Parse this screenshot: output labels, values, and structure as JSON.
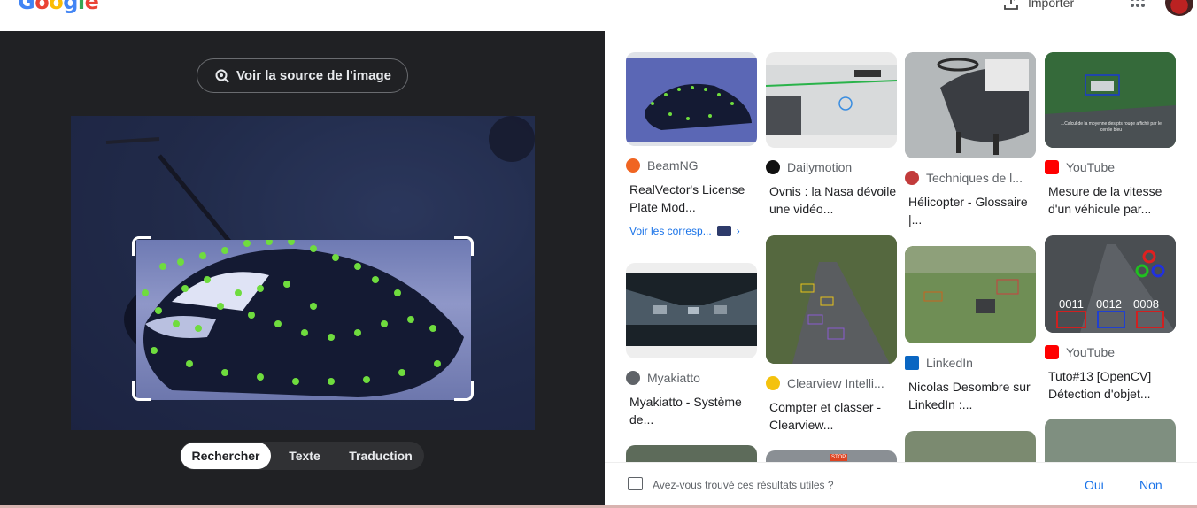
{
  "header": {
    "logo": "Google",
    "import_label": "Importer"
  },
  "lens": {
    "source_button": "Voir la source de l'image",
    "tabs": [
      "Rechercher",
      "Texte",
      "Traduction"
    ]
  },
  "results": [
    {
      "source": "BeamNG",
      "title": "RealVector's License Plate Mod...",
      "match": "Voir les corresp...",
      "icon_color": "#f06522"
    },
    {
      "source": "Dailymotion",
      "title": "Ovnis : la Nasa dévoile une vidéo...",
      "icon_color": "#111111"
    },
    {
      "source": "Techniques de l...",
      "title": "Hélicopter - Glossaire |...",
      "icon_color": "#c23b3b"
    },
    {
      "source": "YouTube",
      "title": "Mesure de la vitesse d'un véhicule par...",
      "icon_color": "#ff0000"
    },
    {
      "source": "Myakiatto",
      "title": "Myakiatto - Système de...",
      "icon_color": "#5f6368"
    },
    {
      "source": "Clearview Intelli...",
      "title": "Compter et classer - Clearview...",
      "icon_color": "#f4c20d"
    },
    {
      "source": "LinkedIn",
      "title": "Nicolas Desombre sur LinkedIn :...",
      "icon_color": "#0a66c2"
    },
    {
      "source": "YouTube",
      "title": "Tuto#13 [OpenCV] Détection d'objet...",
      "icon_color": "#ff0000"
    }
  ],
  "thumb_text": {
    "counters": [
      "0011",
      "0012",
      "0008"
    ],
    "caption": "...Calcul de la moyenne des pts rouge affiché par le cercle bleu",
    "stop": "STOP"
  },
  "feedback": {
    "question": "Avez-vous trouvé ces résultats utiles ?",
    "yes": "Oui",
    "no": "Non"
  }
}
